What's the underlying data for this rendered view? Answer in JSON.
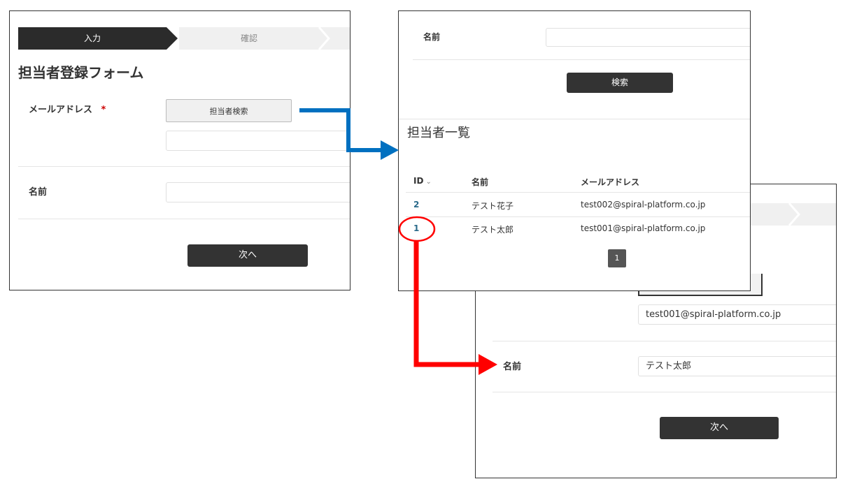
{
  "form": {
    "step_input": "入力",
    "step_confirm": "確認",
    "title": "担当者登録フォーム",
    "email_label": "メールアドレス",
    "required_mark": "*",
    "search_button": "担当者検索",
    "name_label": "名前",
    "next_button": "次へ"
  },
  "search": {
    "name_label": "名前",
    "search_button": "検索",
    "list_title": "担当者一覧",
    "columns": [
      "ID",
      "名前",
      "メールアドレス"
    ],
    "sort_indicator": "⌵",
    "rows": [
      {
        "id": "2",
        "name": "テスト花子",
        "email": "test002@spiral-platform.co.jp"
      },
      {
        "id": "1",
        "name": "テスト太郎",
        "email": "test001@spiral-platform.co.jp"
      }
    ],
    "page": "1"
  },
  "result": {
    "email_value": "test001@spiral-platform.co.jp",
    "name_label": "名前",
    "name_value": "テスト太郎",
    "next_button": "次へ"
  },
  "colors": {
    "blue_arrow": "#0070c0",
    "red_arrow": "#ff0000",
    "dark": "#333333"
  }
}
